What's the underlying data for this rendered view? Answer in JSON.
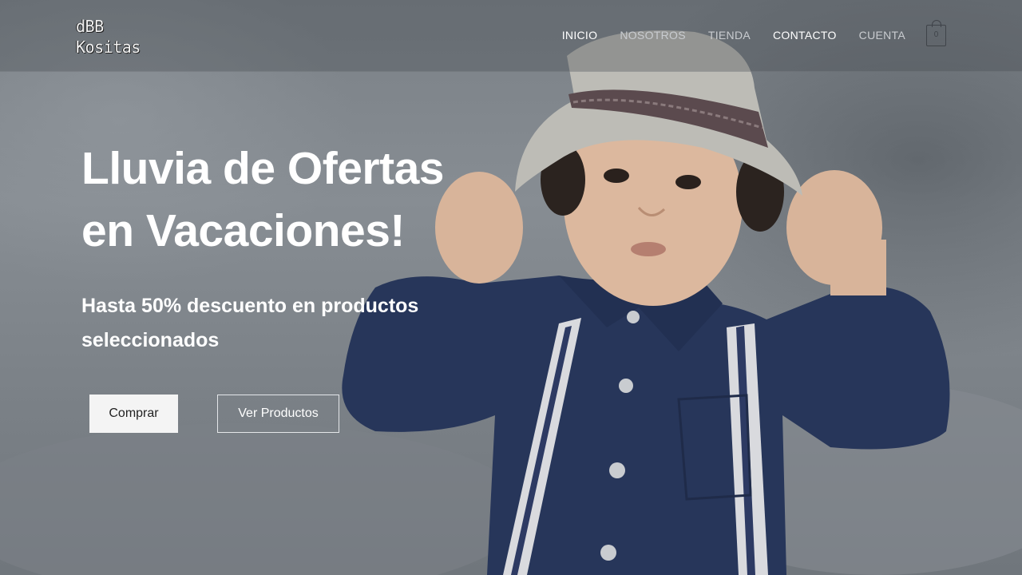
{
  "brand": {
    "line1": "dBB",
    "line2": "Kositas"
  },
  "nav": {
    "items": [
      {
        "label": "INICIO",
        "active": true
      },
      {
        "label": "NOSOTROS",
        "active": false
      },
      {
        "label": "TIENDA",
        "active": false
      },
      {
        "label": "CONTACTO",
        "active": true
      },
      {
        "label": "CUENTA",
        "active": false
      }
    ],
    "cart_count": "0"
  },
  "hero": {
    "headline": "Lluvia de Ofertas en Vacaciones!",
    "subline": "Hasta 50% descuento en productos seleccionados",
    "primary_button": "Comprar",
    "secondary_button": "Ver Productos",
    "image": "child-in-fedora-and-suspenders-photo"
  },
  "colors": {
    "overlay": "#7a8086",
    "shirt": "#27365a",
    "hat": "#bdbcb6",
    "primary_button_bg": "#f4f4f4"
  }
}
